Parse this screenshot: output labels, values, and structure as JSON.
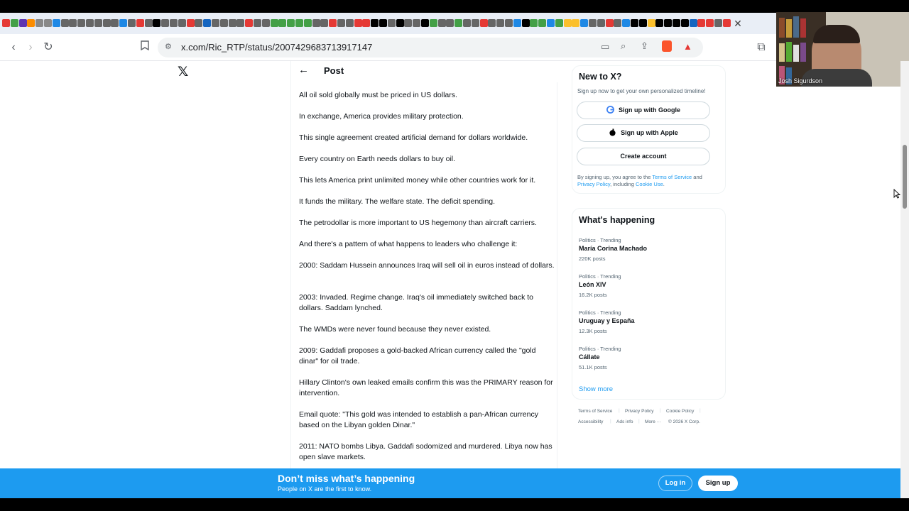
{
  "browser": {
    "url": "x.com/Ric_RTP/status/2007429683713917147",
    "tab_icon_colors": [
      "#e53935",
      "#43a047",
      "#5e35b1",
      "#fb8c00",
      "#888",
      "#888",
      "#1e88e5",
      "#666",
      "#666",
      "#666",
      "#666",
      "#666",
      "#666",
      "#666",
      "#1e88e5",
      "#666",
      "#e53935",
      "#666",
      "#000",
      "#666",
      "#666",
      "#666",
      "#e53935",
      "#666",
      "#1565c0",
      "#666",
      "#666",
      "#666",
      "#666",
      "#e53935",
      "#666",
      "#666",
      "#43a047",
      "#43a047",
      "#43a047",
      "#43a047",
      "#43a047",
      "#666",
      "#666",
      "#e53935",
      "#666",
      "#666",
      "#e53935",
      "#e53935",
      "#000",
      "#000",
      "#666",
      "#000",
      "#666",
      "#666",
      "#000",
      "#43a047",
      "#666",
      "#666",
      "#43a047",
      "#666",
      "#666",
      "#e53935",
      "#666",
      "#666",
      "#666",
      "#1e88e5",
      "#000",
      "#43a047",
      "#43a047",
      "#1e88e5",
      "#43a047",
      "#fbc02d",
      "#fbc02d",
      "#1e88e5",
      "#666",
      "#666",
      "#e53935",
      "#666",
      "#1e88e5",
      "#000",
      "#000",
      "#fbc02d",
      "#000",
      "#000",
      "#000",
      "#000",
      "#1565c0",
      "#e53935",
      "#e53935",
      "#666",
      "#e53935"
    ]
  },
  "webcam": {
    "name": "Josh Sigurdson"
  },
  "post": {
    "title": "Post",
    "lines": [
      "All oil sold globally must be priced in US dollars.",
      "In exchange, America provides military protection.",
      "This single agreement created artificial demand for dollars worldwide.",
      "Every country on Earth needs dollars to buy oil.",
      "This lets America print unlimited money while other countries work for it.",
      "It funds the military. The welfare state. The deficit spending.",
      "The petrodollar is more important to US hegemony than aircraft carriers.",
      "And there's a pattern of what happens to leaders who challenge it:",
      "2000: Saddam Hussein announces Iraq will sell oil in euros instead of dollars.",
      "2003: Invaded. Regime change. Iraq's oil immediately switched back to dollars. Saddam lynched.",
      "The WMDs were never found because they never existed.",
      "2009: Gaddafi proposes a gold-backed African currency called the \"gold dinar\" for oil trade.",
      "Hillary Clinton's own leaked emails confirm this was the PRIMARY reason for intervention.",
      "Email quote: \"This gold was intended to establish a pan-African currency based on the Libyan golden Dinar.\"",
      "2011: NATO bombs Libya. Gaddafi sodomized and murdered. Libya now has open slave markets."
    ]
  },
  "signup": {
    "title": "New to X?",
    "subtitle": "Sign up now to get your own personalized timeline!",
    "google": "Sign up with Google",
    "apple": "Sign up with Apple",
    "create": "Create account",
    "legal_prefix": "By signing up, you agree to the ",
    "terms": "Terms of Service",
    "and": " and ",
    "privacy": "Privacy Policy",
    "including": ", including ",
    "cookie": "Cookie Use",
    "period": "."
  },
  "trending": {
    "title": "What's happening",
    "items": [
      {
        "meta": "Politics · Trending",
        "name": "María Corina Machado",
        "count": "220K posts"
      },
      {
        "meta": "Politics · Trending",
        "name": "León XIV",
        "count": "16.2K posts"
      },
      {
        "meta": "Politics · Trending",
        "name": "Uruguay y España",
        "count": "12.3K posts"
      },
      {
        "meta": "Politics · Trending",
        "name": "Cállate",
        "count": "51.1K posts"
      }
    ],
    "show_more": "Show more"
  },
  "footer": {
    "terms": "Terms of Service",
    "privacy": "Privacy Policy",
    "cookie": "Cookie Policy",
    "accessibility": "Accessibility",
    "ads": "Ads info",
    "more": "More ···",
    "copyright": "© 2026 X Corp."
  },
  "banner": {
    "title": "Don’t miss what’s happening",
    "subtitle": "People on X are the first to know.",
    "login": "Log in",
    "signup": "Sign up"
  },
  "colors": {
    "accent": "#1d9bf0",
    "text": "#0f1419",
    "muted": "#536471"
  }
}
